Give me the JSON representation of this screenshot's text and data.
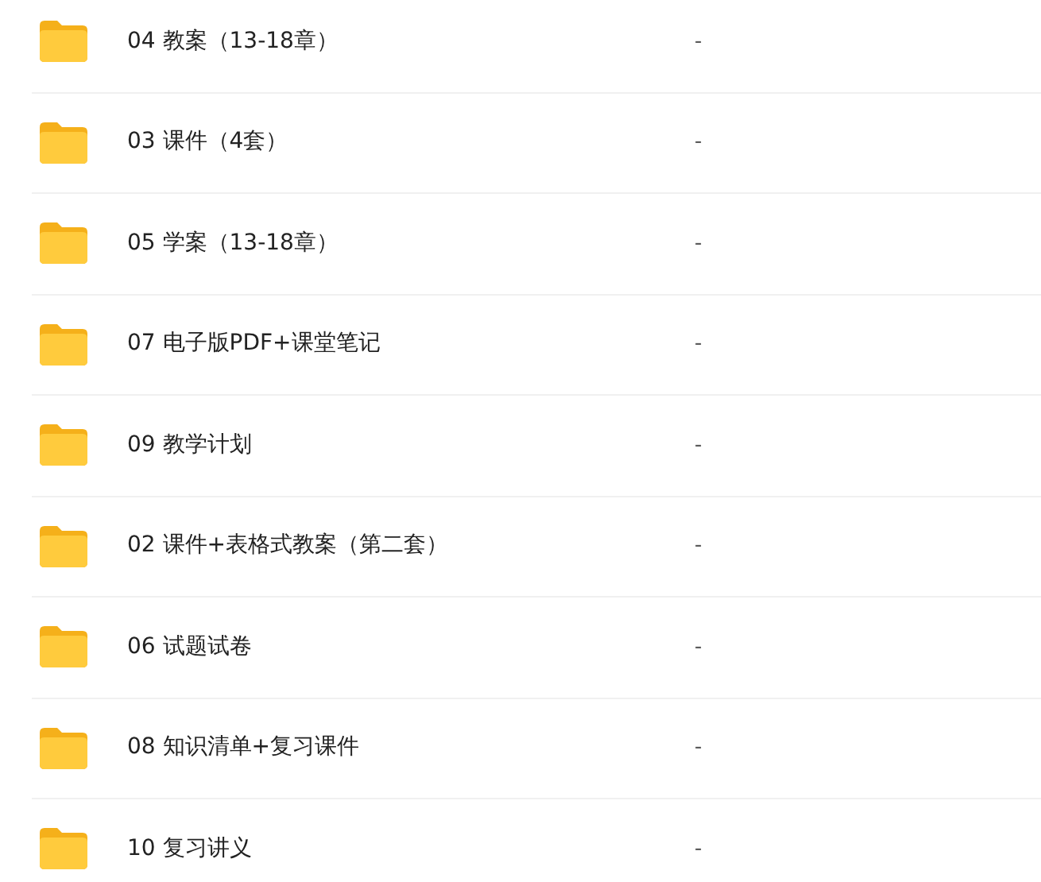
{
  "files": [
    {
      "name": "04 教案（13-18章）",
      "size": "-"
    },
    {
      "name": "03 课件（4套）",
      "size": "-"
    },
    {
      "name": "05 学案（13-18章）",
      "size": "-"
    },
    {
      "name": "07 电子版PDF+课堂笔记",
      "size": "-"
    },
    {
      "name": "09 教学计划",
      "size": "-"
    },
    {
      "name": "02 课件+表格式教案（第二套）",
      "size": "-"
    },
    {
      "name": "06 试题试卷",
      "size": "-"
    },
    {
      "name": "08 知识清单+复习课件",
      "size": "-"
    },
    {
      "name": "10 复习讲义",
      "size": "-"
    }
  ]
}
